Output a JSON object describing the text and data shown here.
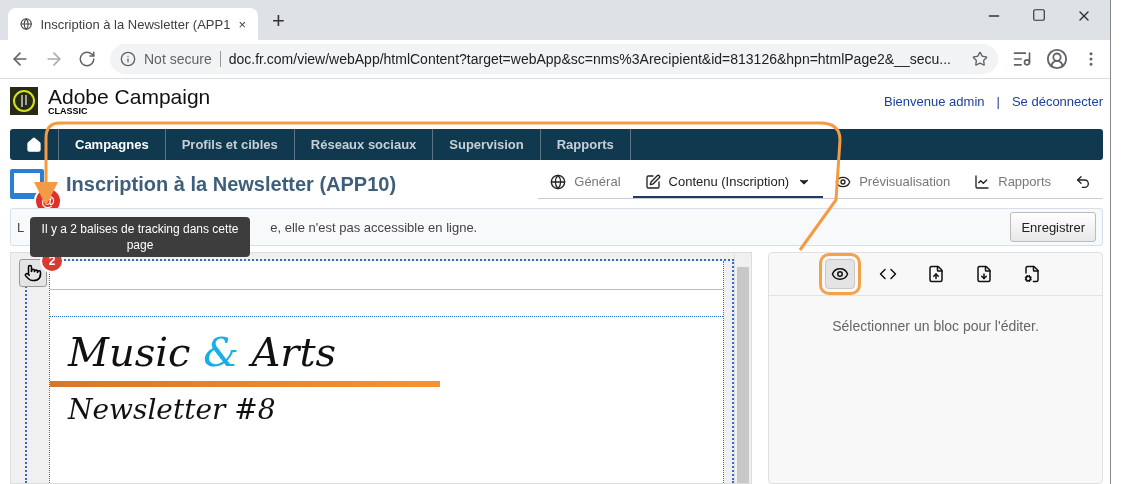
{
  "browser": {
    "tab_title": "Inscription à la Newsletter (APP1",
    "tab_close": "×",
    "new_tab": "+",
    "security": "Not secure",
    "url": "doc.fr.com/view/webApp/htmlContent?target=webApp&sc=nms%3Arecipient&id=813126&hpn=htmlPage2&__secu..."
  },
  "header": {
    "brand": "Adobe Campaign",
    "brand_sub": "CLASSIC",
    "user_links": [
      "Bienvenue admin",
      "Se déconnecter"
    ],
    "separator": "|"
  },
  "nav": [
    {
      "label": "Campagnes",
      "selected": true
    },
    {
      "label": "Profils et cibles",
      "selected": false
    },
    {
      "label": "Réseaux sociaux",
      "selected": false
    },
    {
      "label": "Supervision",
      "selected": false
    },
    {
      "label": "Rapports",
      "selected": false
    }
  ],
  "page_title": "Inscription à la Newsletter (APP10)",
  "email_badge": "@",
  "view_tabs": [
    {
      "label": "Général",
      "selected": false
    },
    {
      "label": "Contenu (Inscription)",
      "selected": true
    },
    {
      "label": "Prévisualisation",
      "selected": false
    },
    {
      "label": "Rapports",
      "selected": false
    }
  ],
  "message": {
    "start": "L",
    "end": "e, elle n'est pas accessible en ligne."
  },
  "save_button": "Enregistrer",
  "tooltip": "Il y a 2 balises de tracking dans cette page",
  "tracking_count": "2",
  "newsletter": {
    "title_before": "Music ",
    "title_accent": "&",
    "title_after": " Arts",
    "subtitle": "Newsletter #8"
  },
  "tools": [
    {
      "selected": true
    },
    {
      "selected": false
    },
    {
      "selected": false
    },
    {
      "selected": false
    },
    {
      "selected": false
    }
  ],
  "panel_hint": "Sélectionner un bloc pour l'éditer."
}
